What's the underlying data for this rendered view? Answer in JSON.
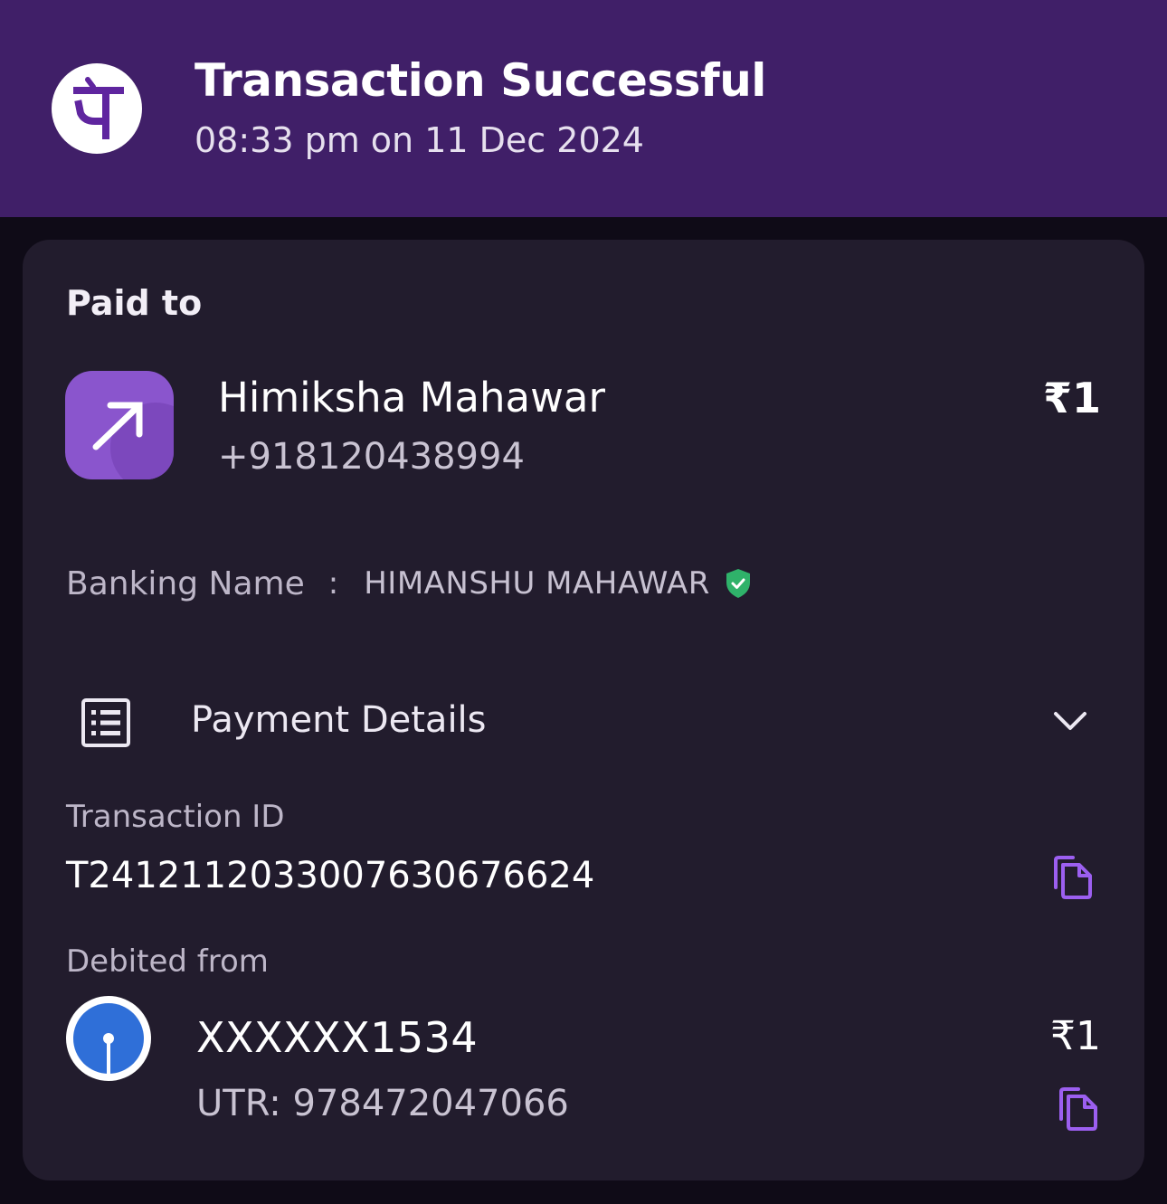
{
  "header": {
    "logo_icon": "phonepe-logo-icon",
    "title": "Transaction Successful",
    "timestamp": "08:33 pm on 11 Dec 2024"
  },
  "paid_to": {
    "section_label": "Paid to",
    "avatar_icon": "arrow-up-right-icon",
    "name": "Himiksha Mahawar",
    "phone": "+918120438994",
    "amount": "₹1"
  },
  "banking": {
    "label": "Banking Name",
    "separator": ":",
    "value": "HIMANSHU MAHAWAR",
    "verified_icon": "verified-shield-icon"
  },
  "payment_details": {
    "icon": "receipt-list-icon",
    "label": "Payment Details",
    "toggle_icon": "chevron-down-icon"
  },
  "transaction": {
    "label": "Transaction ID",
    "id": "T2412112033007630676624",
    "copy_icon": "copy-icon"
  },
  "debited_from": {
    "label": "Debited from",
    "bank_icon": "sbi-bank-logo-icon",
    "account": "XXXXXX1534",
    "amount": "₹1",
    "utr": "UTR: 978472047066",
    "copy_icon": "copy-icon"
  },
  "colors": {
    "header_bg": "#401f68",
    "page_bg": "#0f0b17",
    "card_bg": "#221c2d",
    "accent": "#9c5ff0",
    "avatar_bg": "#8a55cd",
    "verified": "#2fb26a",
    "bank_blue": "#2f6fd8"
  }
}
